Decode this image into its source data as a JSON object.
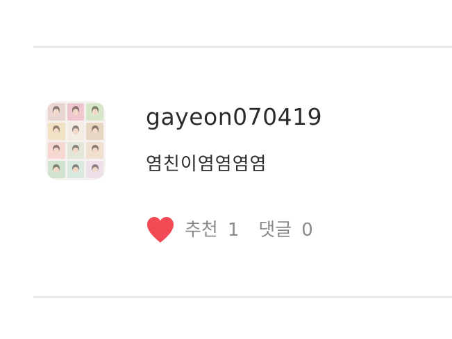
{
  "comment": {
    "username": "gayeon070419",
    "text": "염친이염염염염",
    "recommend_label": "추천",
    "recommend_count": "1",
    "comments_label": "댓글",
    "comments_count": "0",
    "heart_icon": "heart-icon",
    "heart_color": "#f24a55",
    "avatar_tile_colors": [
      "#e9d6d2",
      "#f0c7cf",
      "#d7e6c9",
      "#f1e2c4",
      "#f2ece3",
      "#e6d6c2",
      "#f6d7d2",
      "#e3e7d9",
      "#f0e0cf",
      "#cfe3cf",
      "#d8eadf",
      "#efe1ea"
    ]
  }
}
